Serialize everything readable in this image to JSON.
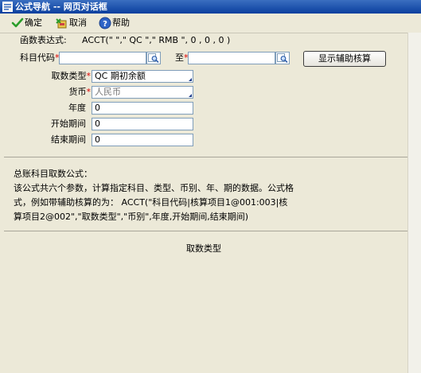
{
  "window": {
    "title": "公式导航 -- 网页对话框"
  },
  "toolbar": {
    "ok_label": "确定",
    "cancel_label": "取消",
    "help_label": "帮助"
  },
  "expression": {
    "label": "函数表达式:",
    "value": "ACCT(\" \",\" QC \",\" RMB \", 0 , 0 , 0 )"
  },
  "subject": {
    "label": "科目代码",
    "from_value": "",
    "to_label": "至",
    "to_value": "",
    "aux_button_label": "显示辅助核算"
  },
  "fields": {
    "fetch_type": {
      "label": "取数类型",
      "value": "QC 期初余额"
    },
    "currency": {
      "label": "货币",
      "value": "人民币"
    },
    "year": {
      "label": "年度",
      "value": "0"
    },
    "start_period": {
      "label": "开始期间",
      "value": "0"
    },
    "end_period": {
      "label": "结束期间",
      "value": "0"
    }
  },
  "description": {
    "title": "总账科目取数公式：",
    "body": "该公式共六个参数，计算指定科目、类型、币别、年、期的数据。公式格式，例如带辅助核算的为： ACCT(\"科目代码|核算项目1@001:003|核算项目2@002\",\"取数类型\",\"币别\",年度,开始期间,结束期间)"
  },
  "bottom_label": "取数类型",
  "colors": {
    "required": "#dd0000",
    "title_bar": "#0a3f9e",
    "dialog_bg": "#ece9d8"
  }
}
